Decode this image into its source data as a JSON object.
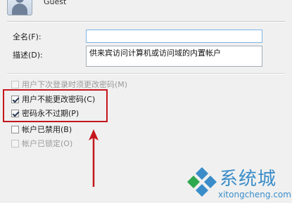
{
  "user": {
    "name": "Guest"
  },
  "form": {
    "fullname_label": "全名(F):",
    "fullname_value": "",
    "description_label": "描述(D):",
    "description_value": "供来宾访问计算机或访问域的内置帐户"
  },
  "options": [
    {
      "label": "用户下次登录时须更改密码(M)",
      "checked": false,
      "disabled": true
    },
    {
      "label": "用户不能更改密码(C)",
      "checked": true,
      "disabled": false
    },
    {
      "label": "密码永不过期(P)",
      "checked": true,
      "disabled": false
    },
    {
      "label": "帐户已禁用(B)",
      "checked": false,
      "disabled": false
    },
    {
      "label": "帐户已锁定(O)",
      "checked": false,
      "disabled": true
    }
  ],
  "watermark": {
    "brand": "系统城",
    "url": "xitongcheng.com"
  },
  "colors": {
    "highlight": "#c4161c",
    "brand": "#3a8dc9"
  }
}
